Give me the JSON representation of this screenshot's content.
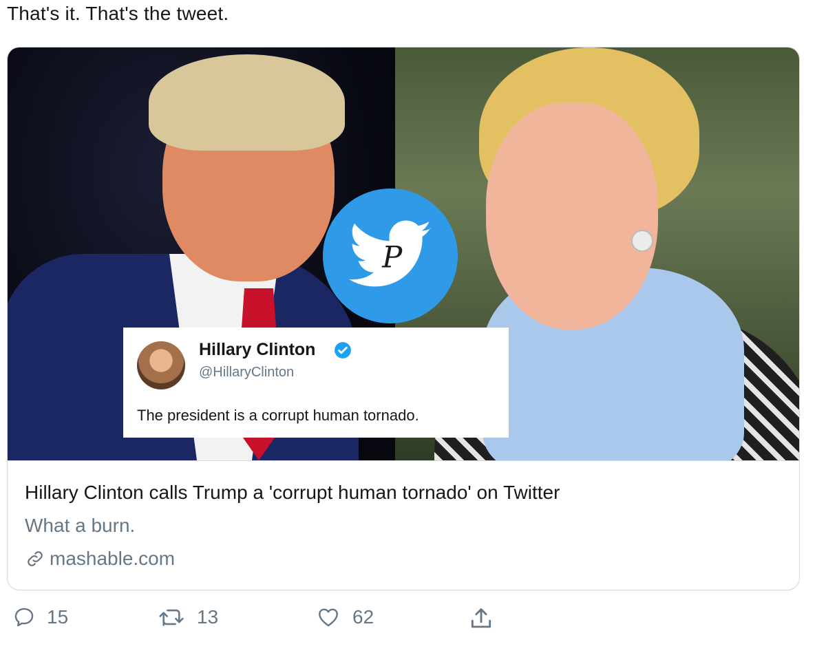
{
  "tweet": {
    "text": "That's it. That's the tweet."
  },
  "card": {
    "quote": {
      "name": "Hillary Clinton",
      "handle": "@HillaryClinton",
      "text": "The president is a corrupt human tornado."
    },
    "title": "Hillary Clinton calls Trump a 'corrupt human tornado' on Twitter",
    "description": "What a burn.",
    "domain": "mashable.com"
  },
  "actions": {
    "reply_count": "15",
    "retweet_count": "13",
    "like_count": "62"
  },
  "colors": {
    "twitter_blue": "#2f9be8",
    "secondary_text": "#657786",
    "border": "#cfd9de"
  }
}
